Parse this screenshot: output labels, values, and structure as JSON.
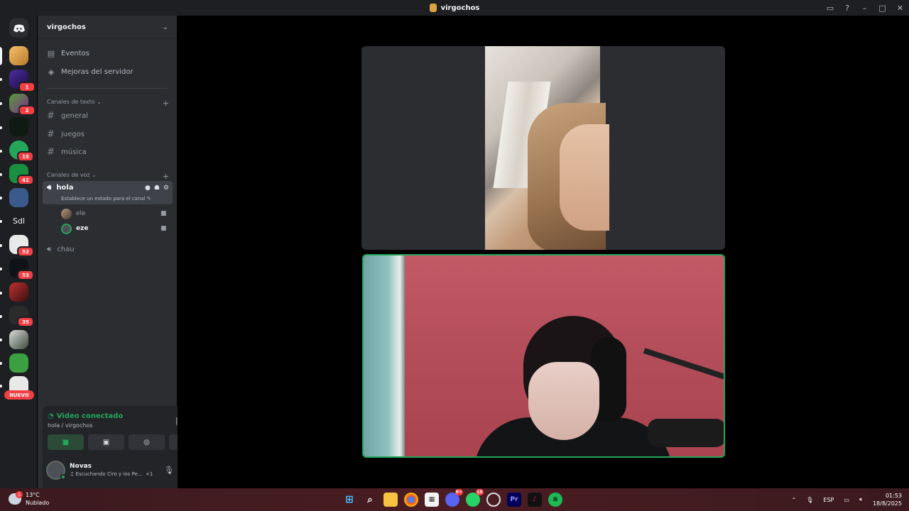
{
  "window": {
    "title": "virgochos"
  },
  "rail": {
    "badges": [
      "1",
      "2",
      "15",
      "42",
      "52",
      "53",
      "35"
    ],
    "sdl_label": "Sdl",
    "new_label": "NUEVO"
  },
  "server": {
    "name": "virgochos",
    "menu_items": [
      "Eventos",
      "Mejoras del servidor"
    ],
    "text_category": "Canales de texto",
    "text_channels": [
      "general",
      "juegos",
      "música"
    ],
    "voice_category": "Canales de voz",
    "active_voice_channel": "hola",
    "active_voice_status": "Establece un estado para el canal",
    "voice_members": [
      "ele",
      "eze"
    ],
    "other_voice_channel": "chau"
  },
  "voice_panel": {
    "title": "Video conectado",
    "subtitle": "hola / virgochos"
  },
  "user": {
    "name": "Novas",
    "activity": "Escuchando Ciro y los Pe...",
    "activity_extra": "+1"
  },
  "taskbar": {
    "weather_temp": "13°C",
    "weather_desc": "Nublado",
    "weather_badge": "1",
    "discord_badge": "9+",
    "whatsapp_badge": "15",
    "lang": "ESP",
    "time": "01:53",
    "date": "18/8/2025"
  },
  "colors": {
    "connected_green": "#23a55a",
    "badge_red": "#f23f43",
    "sidebar_bg": "#2b2d31",
    "rail_bg": "#1e1f22"
  }
}
